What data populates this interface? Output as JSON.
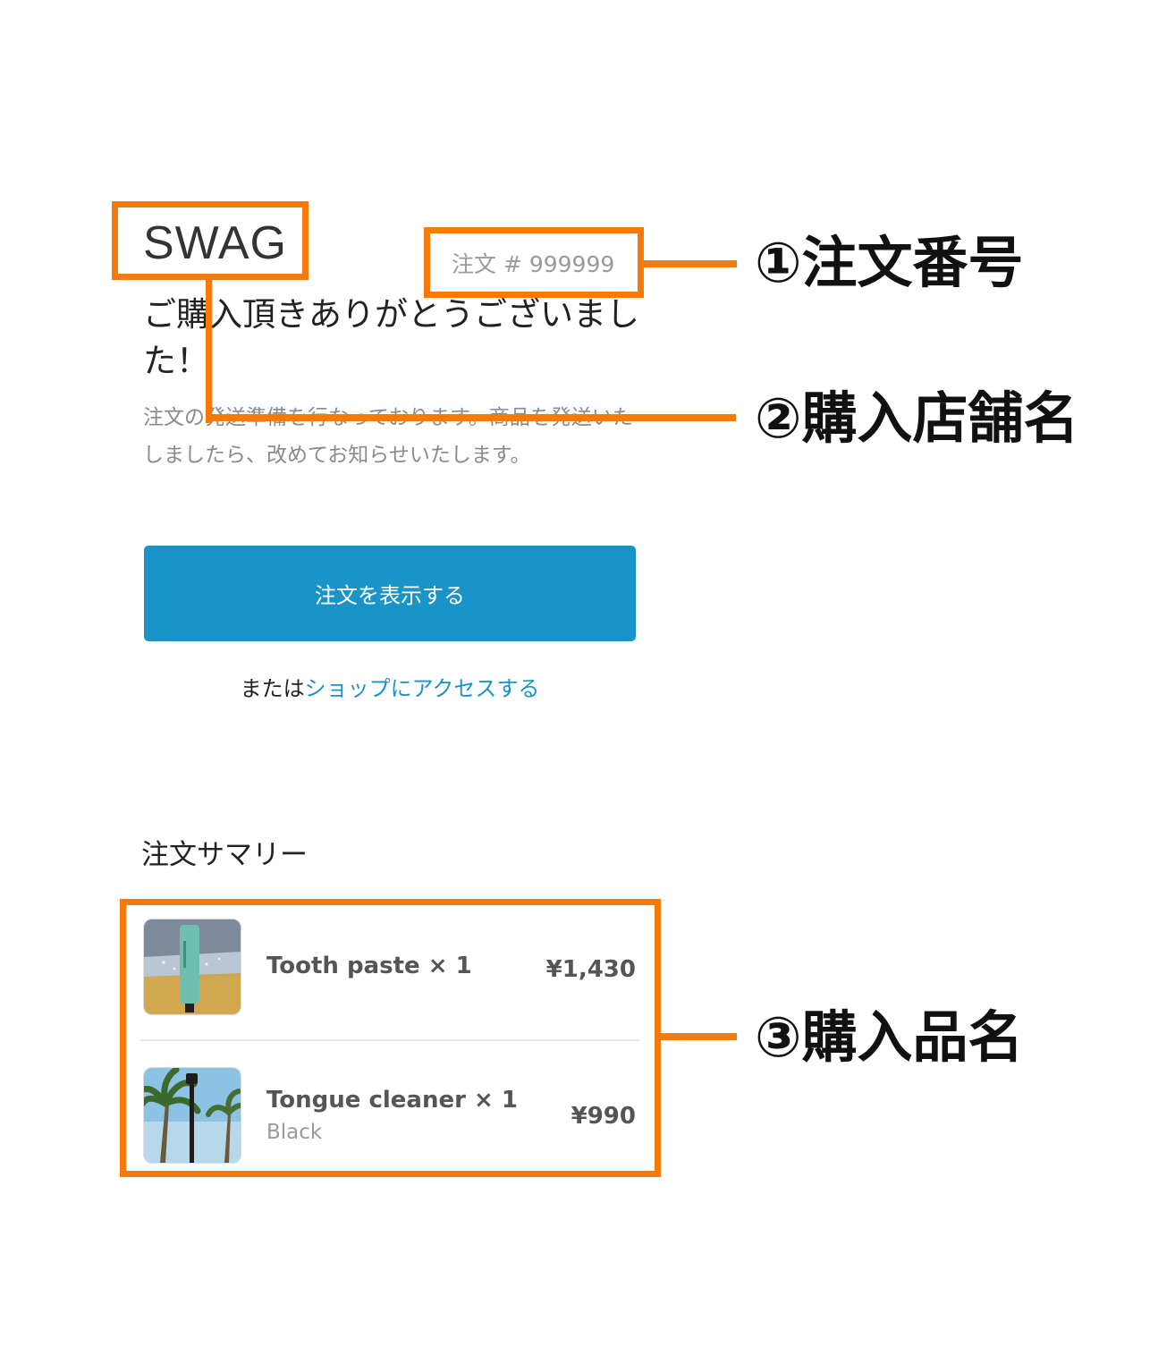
{
  "store": {
    "name": "SWAG",
    "order_number": "注文 # 999999"
  },
  "confirmation": {
    "title": "ご購入頂きありがとうございました！",
    "message": "注文の発送準備を行なっております。商品を発送いたしましたら、改めてお知らせいたします。",
    "view_order_label": "注文を表示する",
    "or_text": "または",
    "shop_link_label": "ショップにアクセスする"
  },
  "summary": {
    "heading": "注文サマリー",
    "items": [
      {
        "name": "Tooth paste × 1",
        "variant": "",
        "price": "¥1,430"
      },
      {
        "name": "Tongue cleaner × 1",
        "variant": "Black",
        "price": "¥990"
      }
    ]
  },
  "annotations": {
    "order_number_label": "①注文番号",
    "store_name_label": "②購入店舗名",
    "items_label": "③購入品名",
    "accent_color": "#f57a0a"
  },
  "colors": {
    "button": "#1a93c8",
    "link": "#1a93c8"
  }
}
